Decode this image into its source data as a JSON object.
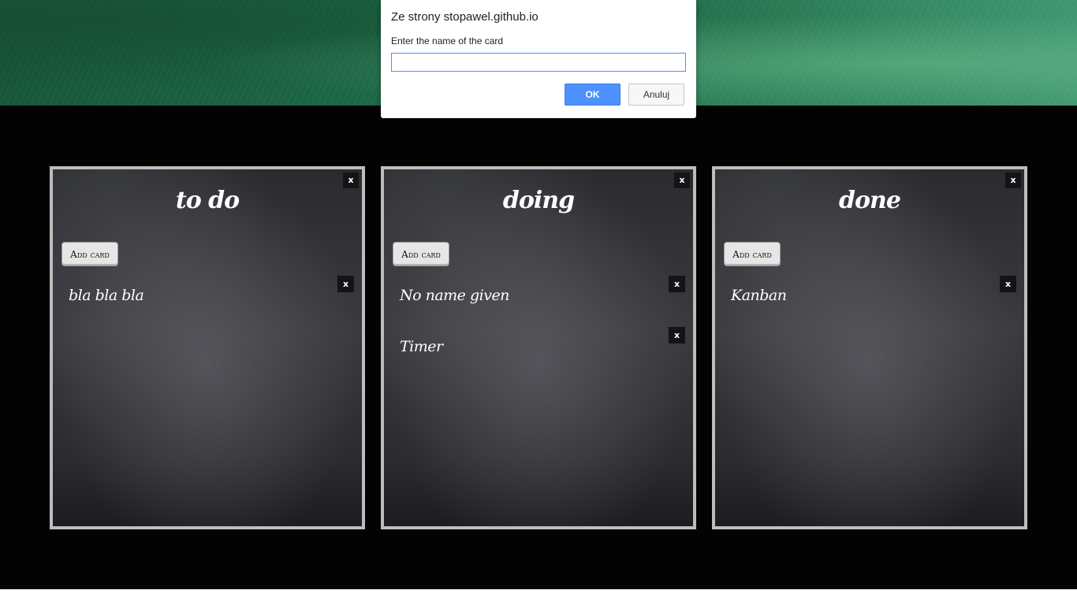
{
  "dialog": {
    "origin": "Ze strony stopawel.github.io",
    "message": "Enter the name of the card",
    "input_value": "",
    "ok_label": "OK",
    "cancel_label": "Anuluj"
  },
  "columns": [
    {
      "title": "to do",
      "close_label": "x",
      "add_card_label": "Add card",
      "cards": [
        {
          "title": "bla bla bla",
          "close_label": "x"
        }
      ]
    },
    {
      "title": "doing",
      "close_label": "x",
      "add_card_label": "Add card",
      "cards": [
        {
          "title": "No name given",
          "close_label": "x"
        },
        {
          "title": "Timer",
          "close_label": "x"
        }
      ]
    },
    {
      "title": "done",
      "close_label": "x",
      "add_card_label": "Add card",
      "cards": [
        {
          "title": "Kanban",
          "close_label": "x"
        }
      ]
    }
  ]
}
